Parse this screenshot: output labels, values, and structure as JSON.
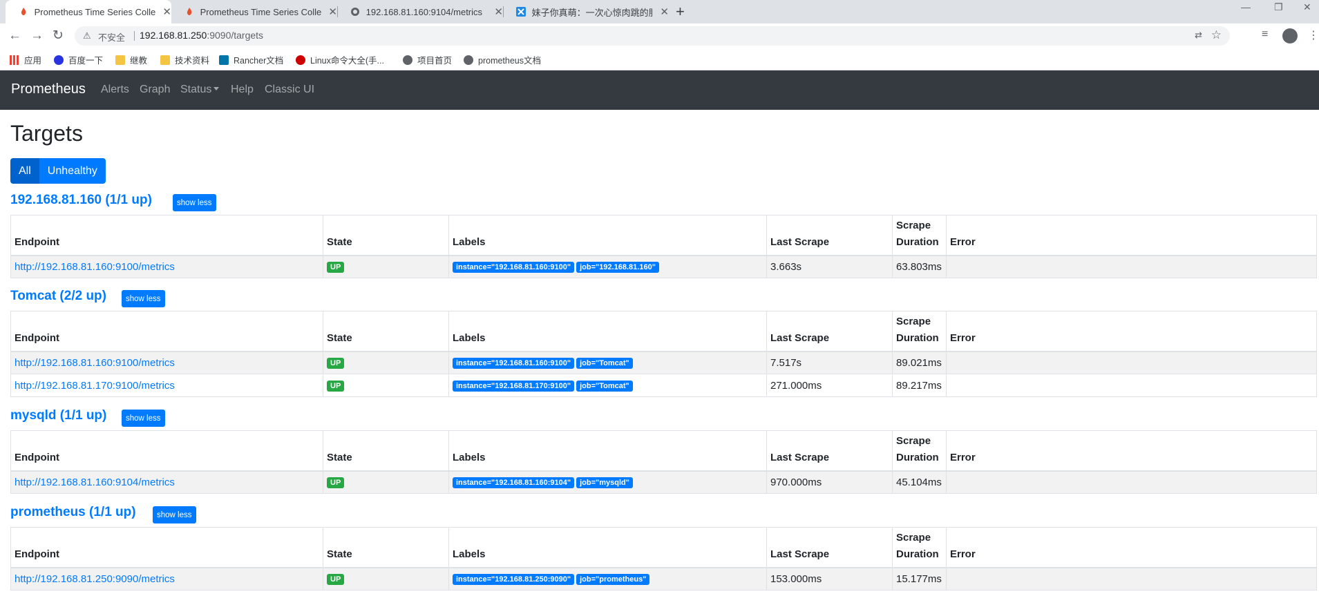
{
  "browser": {
    "tabs": [
      {
        "title": "Prometheus Time Series Collec",
        "icon": "prometheus-icon",
        "active": true
      },
      {
        "title": "Prometheus Time Series Collec",
        "icon": "prometheus-icon",
        "active": false
      },
      {
        "title": "192.168.81.160:9104/metrics",
        "icon": "globe-icon",
        "active": false
      },
      {
        "title": "妹子你真萌：一次心惊肉跳的服务",
        "icon": "site-icon",
        "active": false
      }
    ],
    "insecure_label": "不安全",
    "url_host": "192.168.81.250",
    "url_rest": ":9090/targets",
    "bookmarks": [
      {
        "label": "应用"
      },
      {
        "label": "百度一下"
      },
      {
        "label": "继教"
      },
      {
        "label": "技术资料"
      },
      {
        "label": "Rancher文档"
      },
      {
        "label": "Linux命令大全(手..."
      },
      {
        "label": "项目首页"
      },
      {
        "label": "prometheus文档"
      }
    ]
  },
  "navbar": {
    "brand": "Prometheus",
    "links": [
      "Alerts",
      "Graph",
      "Status",
      "Help",
      "Classic UI"
    ]
  },
  "page": {
    "title": "Targets",
    "filters": {
      "all": "All",
      "unhealthy": "Unhealthy"
    },
    "show_less": "show less",
    "columns": {
      "endpoint": "Endpoint",
      "state": "State",
      "labels": "Labels",
      "last_scrape": "Last Scrape",
      "scrape_duration_1": "Scrape",
      "scrape_duration_2": "Duration",
      "error": "Error"
    }
  },
  "pools": [
    {
      "title": "192.168.81.160 (1/1 up)",
      "targets": [
        {
          "endpoint": "http://192.168.81.160:9100/metrics",
          "state": "UP",
          "labels": [
            "instance=\"192.168.81.160:9100\"",
            "job=\"192.168.81.160\""
          ],
          "last_scrape": "3.663s",
          "duration": "63.803ms",
          "error": ""
        }
      ]
    },
    {
      "title": "Tomcat (2/2 up)",
      "targets": [
        {
          "endpoint": "http://192.168.81.160:9100/metrics",
          "state": "UP",
          "labels": [
            "instance=\"192.168.81.160:9100\"",
            "job=\"Tomcat\""
          ],
          "last_scrape": "7.517s",
          "duration": "89.021ms",
          "error": ""
        },
        {
          "endpoint": "http://192.168.81.170:9100/metrics",
          "state": "UP",
          "labels": [
            "instance=\"192.168.81.170:9100\"",
            "job=\"Tomcat\""
          ],
          "last_scrape": "271.000ms",
          "duration": "89.217ms",
          "error": ""
        }
      ]
    },
    {
      "title": "mysqld (1/1 up)",
      "targets": [
        {
          "endpoint": "http://192.168.81.160:9104/metrics",
          "state": "UP",
          "labels": [
            "instance=\"192.168.81.160:9104\"",
            "job=\"mysqld\""
          ],
          "last_scrape": "970.000ms",
          "duration": "45.104ms",
          "error": ""
        }
      ]
    },
    {
      "title": "prometheus (1/1 up)",
      "targets": [
        {
          "endpoint": "http://192.168.81.250:9090/metrics",
          "state": "UP",
          "labels": [
            "instance=\"192.168.81.250:9090\"",
            "job=\"prometheus\""
          ],
          "last_scrape": "153.000ms",
          "duration": "15.177ms",
          "error": ""
        }
      ]
    }
  ]
}
